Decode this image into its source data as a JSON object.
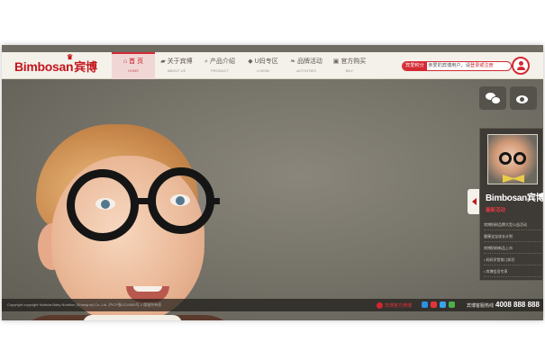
{
  "brand": {
    "name": "Bimbosan",
    "name_cn": "宾博"
  },
  "nav": {
    "items": [
      {
        "cn": "首 页",
        "en": "HOME",
        "icon": "home-icon",
        "active": true
      },
      {
        "cn": "关于宾博",
        "en": "ABOUT US",
        "icon": "car-icon",
        "active": false
      },
      {
        "cn": "产品介绍",
        "en": "PRODUCT",
        "icon": "search-icon",
        "active": false
      },
      {
        "cn": "U妈专区",
        "en": "U MOM",
        "icon": "shield-icon",
        "active": false
      },
      {
        "cn": "品牌活动",
        "en": "ACTIVITIES",
        "icon": "leaf-icon",
        "active": false
      },
      {
        "cn": "官方购买",
        "en": "BUY",
        "icon": "cart-icon",
        "active": false
      }
    ]
  },
  "login": {
    "badge": "宾爱积分",
    "prefix": "亲爱的宾博用户，请",
    "link": "登录或注册"
  },
  "social": {
    "wechat": "wechat-icon",
    "weibo": "weibo-icon"
  },
  "panel": {
    "logo": "Bimbosan宾博",
    "title": "最新活动",
    "items": [
      "宾博奶粉品牌大型公益活动",
      "健康宝宝成长计划",
      "宾博奶粉新品上市",
      "• 妈妈学堂育儿知识",
      "• 宾博会员专享"
    ]
  },
  "footer": {
    "copyright": "Copyright copyright Nutricia Baby Nutrition (Shanghai) Co.,Ltd. 沪ICP备1234560号-1 保留所有权",
    "red_link": "宾博官方微博",
    "hotline_label": "宾博客服热线",
    "hotline_number": "4008 888 888"
  },
  "colors": {
    "brand_red": "#c4151c",
    "header_bg": "#f4f1ea",
    "panel_bg": "#3e3a35"
  }
}
